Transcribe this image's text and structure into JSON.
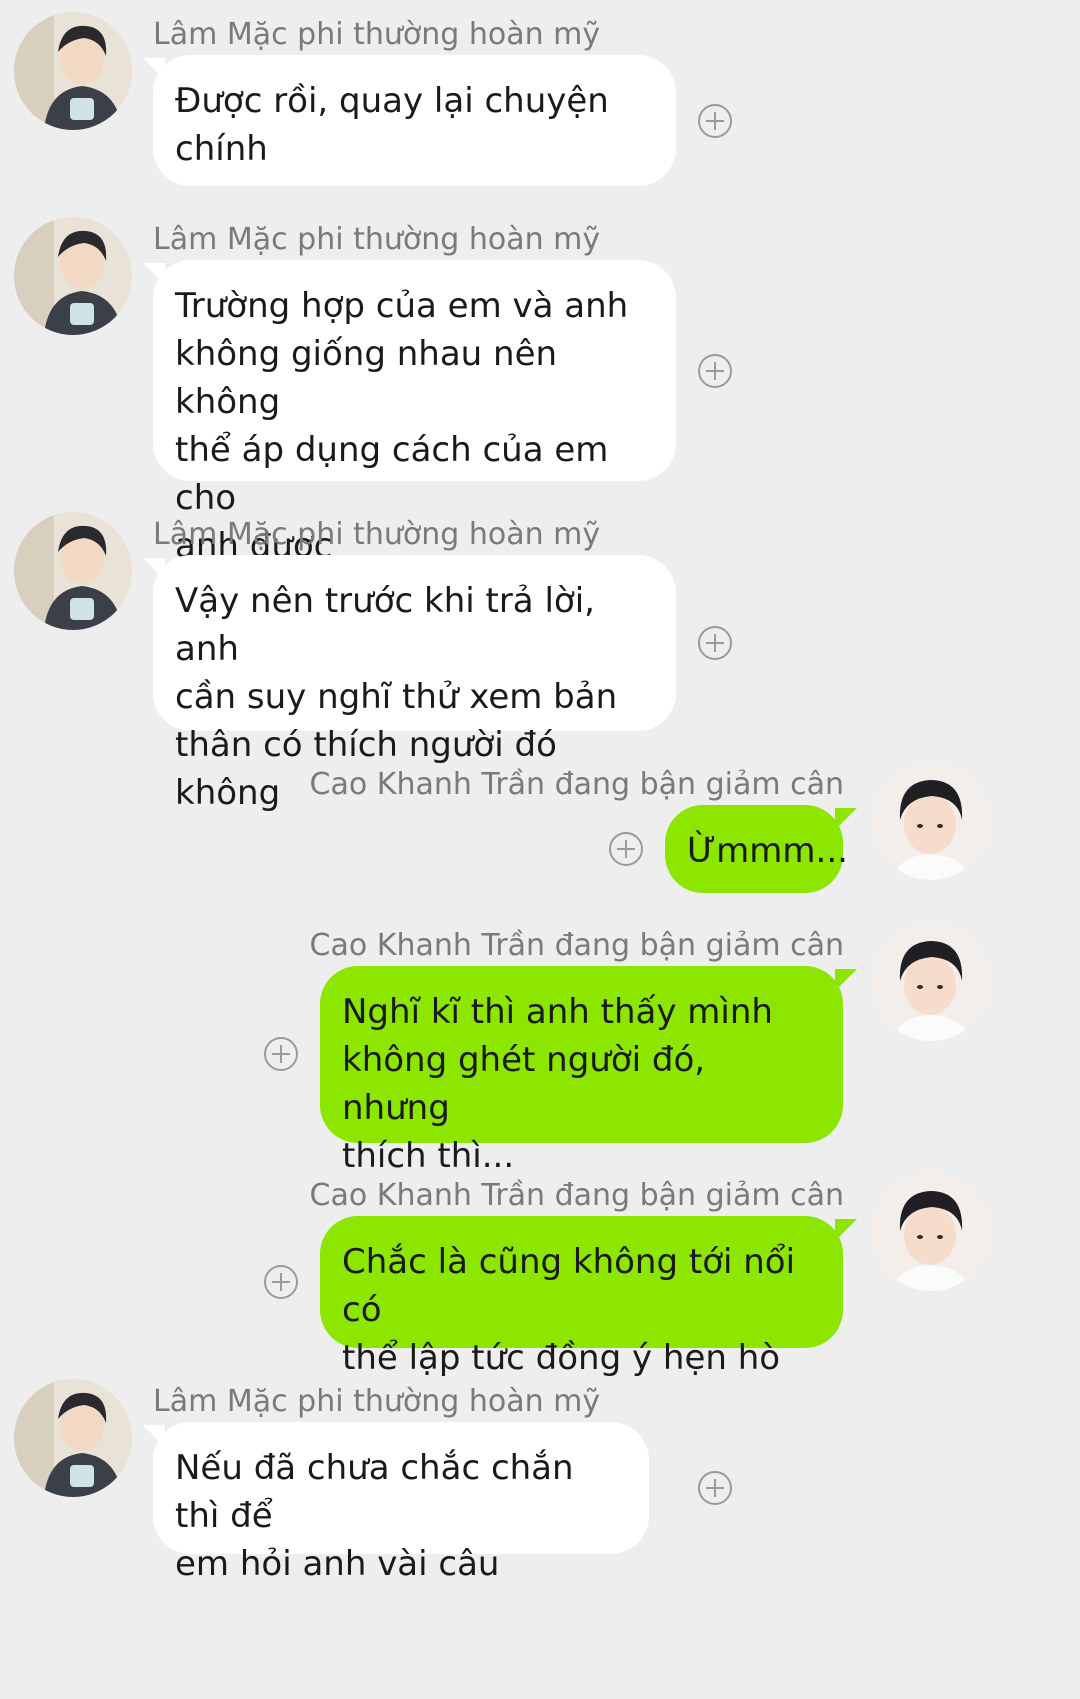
{
  "contacts": {
    "other": "Lâm Mặc phi thường hoàn mỹ",
    "me": "Cao Khanh Trần đang bận giảm cân"
  },
  "colors": {
    "background": "#eeeeee",
    "incoming_bubble": "#ffffff",
    "outgoing_bubble": "#8ce600",
    "name_text": "#7a7a7a",
    "add_icon": "#9a9a9a"
  },
  "messages": [
    {
      "sender": "Lâm Mặc phi thường hoàn mỹ",
      "direction": "incoming",
      "lines": [
        "Được rồi, quay lại chuyện",
        "chính"
      ]
    },
    {
      "sender": "Lâm Mặc phi thường hoàn mỹ",
      "direction": "incoming",
      "lines": [
        "Trường hợp của em và anh",
        "không giống nhau nên không",
        "thể áp dụng cách của em cho",
        "anh được"
      ]
    },
    {
      "sender": "Lâm Mặc phi thường hoàn mỹ",
      "direction": "incoming",
      "lines": [
        "Vậy nên trước khi trả lời, anh",
        "cần suy nghĩ thử xem bản",
        "thân có thích người đó không"
      ]
    },
    {
      "sender": "Cao Khanh Trần đang bận giảm cân",
      "direction": "outgoing",
      "lines": [
        "Ừmmm..."
      ]
    },
    {
      "sender": "Cao Khanh Trần đang bận giảm cân",
      "direction": "outgoing",
      "lines": [
        "Nghĩ kĩ thì anh thấy mình",
        "không ghét người đó, nhưng",
        "thích thì..."
      ]
    },
    {
      "sender": "Cao Khanh Trần đang bận giảm cân",
      "direction": "outgoing",
      "lines": [
        "Chắc là cũng không tới nổi có",
        "thể lập tức đồng ý hẹn hò"
      ]
    },
    {
      "sender": "Lâm Mặc phi thường hoàn mỹ",
      "direction": "incoming",
      "lines": [
        "Nếu đã chưa chắc chắn thì để",
        "em hỏi anh vài câu"
      ]
    }
  ],
  "icons": {
    "add": "plus-circle-icon",
    "avatar_other": "avatar-lam-mac",
    "avatar_me": "avatar-cao-khanh-tran"
  }
}
